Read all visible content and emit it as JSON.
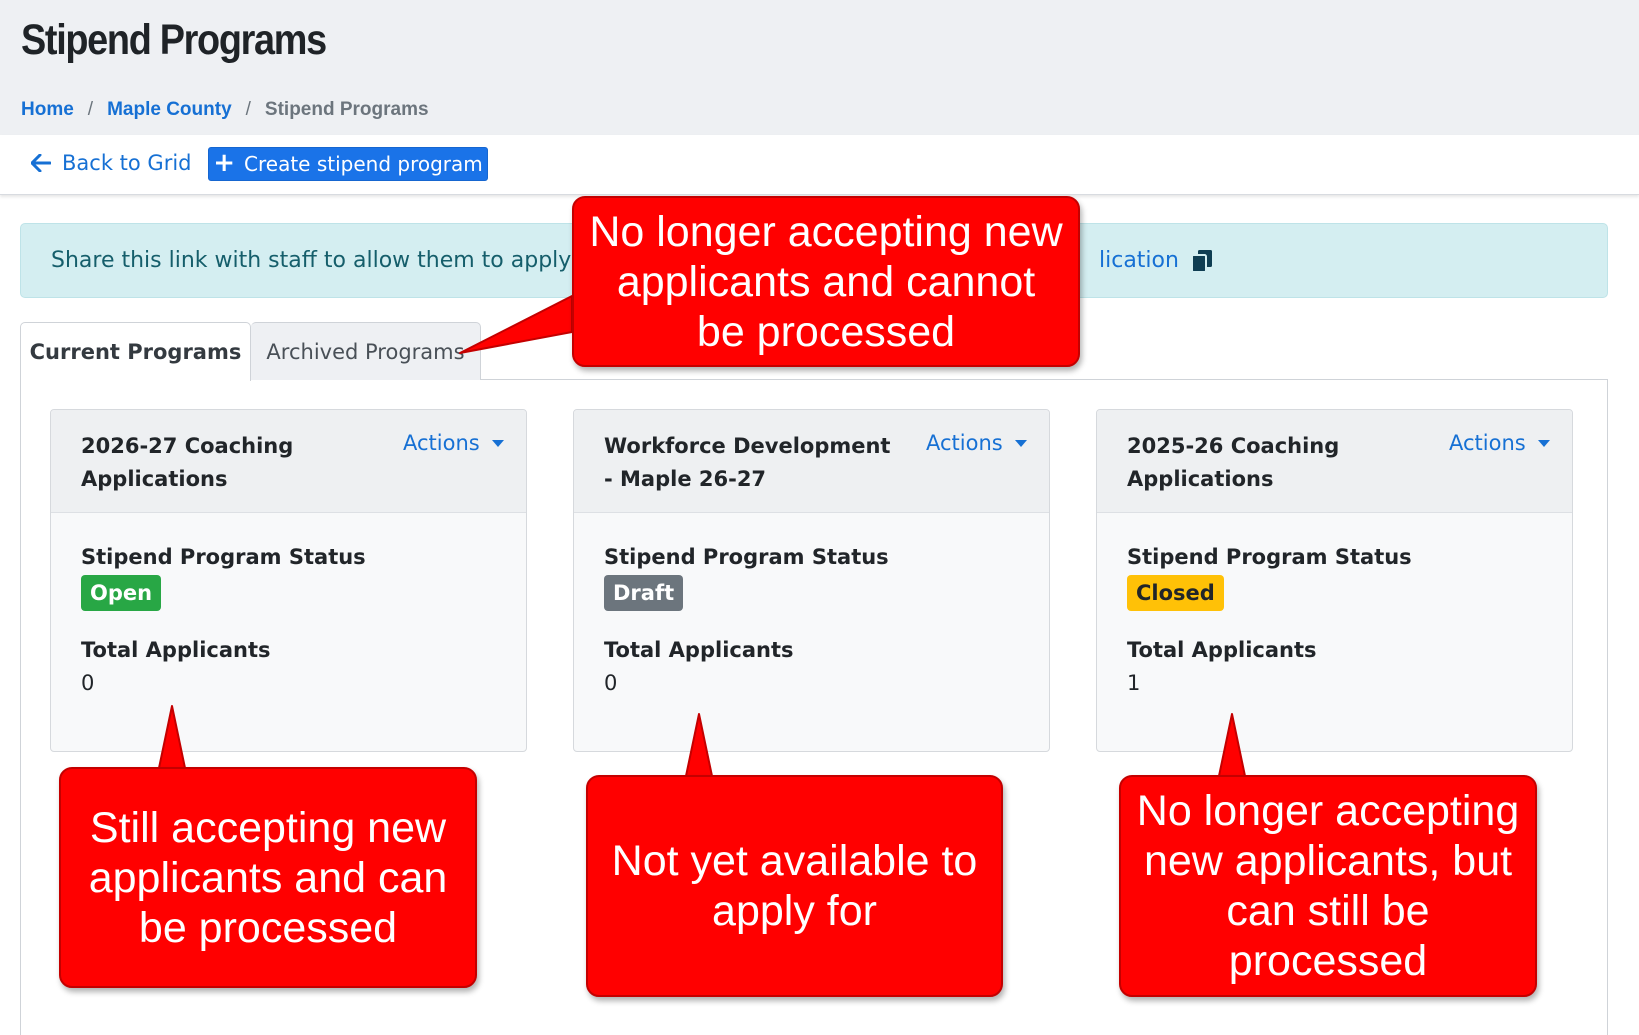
{
  "page": {
    "title": "Stipend Programs"
  },
  "breadcrumb": {
    "items": [
      "Home",
      "Maple County"
    ],
    "separator": "/",
    "current": "Stipend Programs"
  },
  "toolbar": {
    "back_label": "Back to Grid",
    "create_label": "Create stipend program"
  },
  "info_alert": {
    "text": "Share this link with staff to allow them to apply fo",
    "link_text": "lication",
    "icon": "copy-icon"
  },
  "tabs": [
    {
      "label": "Current Programs",
      "active": true
    },
    {
      "label": "Archived Programs",
      "active": false
    }
  ],
  "programs": [
    {
      "title": "2026-27 Coaching Applications",
      "actions_label": "Actions",
      "status_label": "Stipend Program Status",
      "status": "Open",
      "applicants_label": "Total Applicants",
      "applicants": "0"
    },
    {
      "title": "Workforce Development - Maple 26-27",
      "actions_label": "Actions",
      "status_label": "Stipend Program Status",
      "status": "Draft",
      "applicants_label": "Total Applicants",
      "applicants": "0"
    },
    {
      "title": "2025-26 Coaching Applications",
      "actions_label": "Actions",
      "status_label": "Stipend Program Status",
      "status": "Closed",
      "applicants_label": "Total Applicants",
      "applicants": "1"
    }
  ],
  "annotations": {
    "archived": "No longer accepting new applicants and cannot be processed",
    "open": "Still accepting new applicants and can be processed",
    "draft": "Not yet available to apply for",
    "closed": "No longer accepting new applicants, but can still be processed"
  },
  "colors": {
    "primary": "#1a73e8",
    "link": "#1670d4",
    "open": "#28a745",
    "draft": "#6c757d",
    "closed": "#ffc107",
    "info_bg": "#d4eef1",
    "callout": "#ff0000"
  }
}
